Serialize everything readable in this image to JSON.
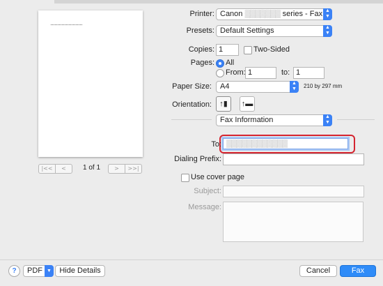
{
  "preview": {
    "page_indicator": "1 of 1",
    "nav_first": "|<<",
    "nav_prev": "<",
    "nav_next": ">",
    "nav_last": ">>|"
  },
  "printer": {
    "label": "Printer:",
    "value_prefix": "Canon",
    "value_redacted": "▒▒▒▒▒▒▒",
    "value_suffix": "series - Fax"
  },
  "presets": {
    "label": "Presets:",
    "value": "Default Settings"
  },
  "copies": {
    "label": "Copies:",
    "value": "1",
    "two_sided_label": "Two-Sided"
  },
  "pages": {
    "label": "Pages:",
    "all_label": "All",
    "from_label": "From:",
    "from_value": "1",
    "to_label": "to:",
    "to_value": "1",
    "selected": "All"
  },
  "paper_size": {
    "label": "Paper Size:",
    "value": "A4",
    "dimensions": "210 by 297 mm"
  },
  "orientation": {
    "label": "Orientation:",
    "portrait_icon": "portrait-icon",
    "landscape_icon": "landscape-icon",
    "selected": "portrait"
  },
  "section": {
    "value": "Fax Information"
  },
  "fax": {
    "to_label": "To:",
    "to_value_redacted": "▒▒▒▒▒▒▒▒▒▒▒▒",
    "dialing_prefix_label": "Dialing Prefix:",
    "dialing_prefix_value": "",
    "use_cover_page_label": "Use cover page",
    "subject_label": "Subject:",
    "message_label": "Message:"
  },
  "footer": {
    "help_label": "?",
    "pdf_label": "PDF",
    "hide_details_label": "Hide Details",
    "cancel_label": "Cancel",
    "fax_label": "Fax"
  },
  "colors": {
    "accent": "#3b82f6",
    "highlight_box": "#d4242f"
  }
}
